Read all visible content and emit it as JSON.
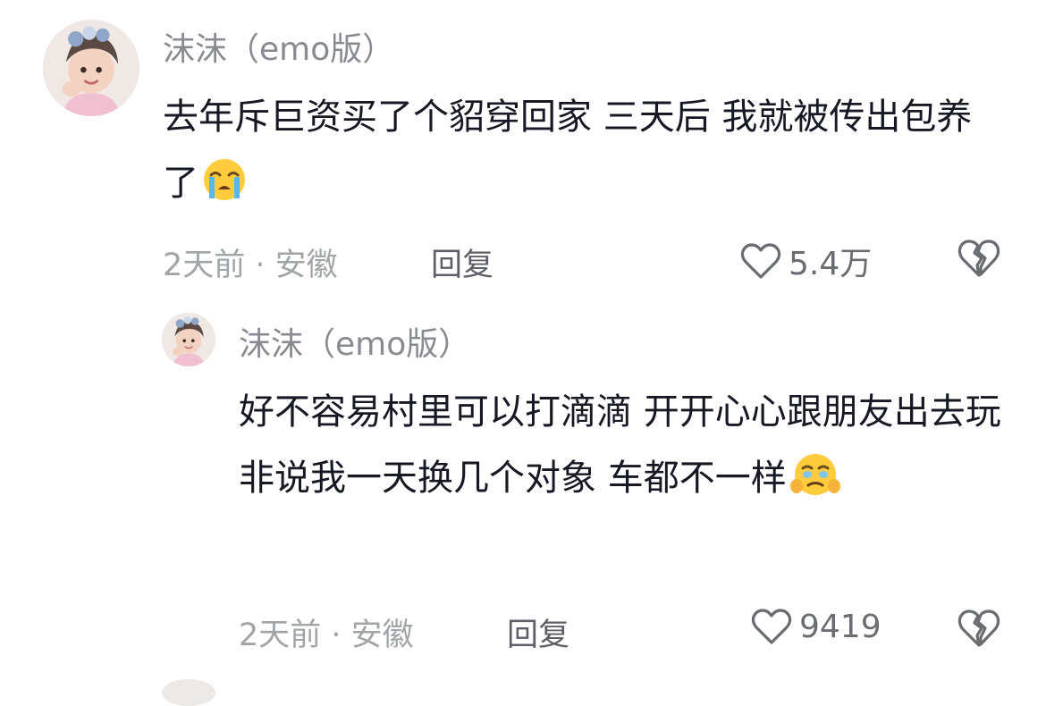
{
  "comments": [
    {
      "username": "沫沫（emo版）",
      "text": "去年斥巨资买了个貂穿回家 三天后 我就被传出包养了",
      "emoji": "loudly-crying-face",
      "meta": "2天前 · 安徽",
      "reply_label": "回复",
      "like_count": "5.4万"
    },
    {
      "username": "沫沫（emo版）",
      "text": "好不容易村里可以打滴滴 开开心心跟朋友出去玩 非说我一天换几个对象 车都不一样",
      "emoji": "face-holding-back-tears",
      "meta": "2天前 · 安徽",
      "reply_label": "回复",
      "like_count": "9419"
    }
  ],
  "colors": {
    "username": "#8a8b91",
    "text": "#161823",
    "meta": "#a3a4a8",
    "reply": "#5e5f66",
    "icon_stroke": "#6b6c72"
  },
  "icons": {
    "like": "heart-outline-icon",
    "dislike": "broken-heart-icon"
  }
}
